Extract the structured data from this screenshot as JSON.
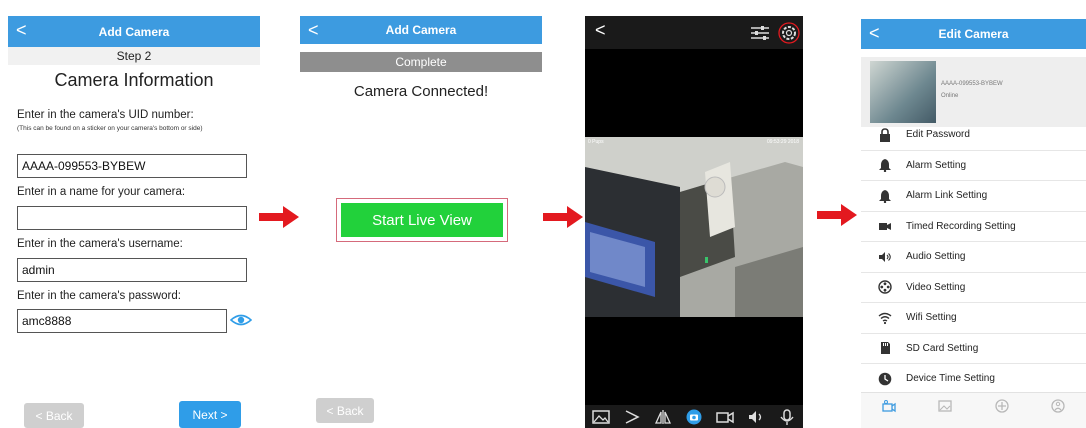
{
  "panel1": {
    "header_title": "Add Camera",
    "back_glyph": "<",
    "step": "Step 2",
    "title": "Camera Information",
    "uid_label": "Enter in the camera's UID number:",
    "uid_note": "(This can be found on a sticker on your camera's bottom or side)",
    "uid_value": "AAAA-099553-BYBEW",
    "name_label": "Enter in a name for your camera:",
    "name_value": "",
    "username_label": "Enter in the camera's username:",
    "username_value": "admin",
    "password_label": "Enter in the camera's password:",
    "password_value": "amc8888",
    "eye_icon": "eye-icon",
    "back_button": "< Back",
    "next_button": "Next >"
  },
  "panel2": {
    "header_title": "Add Camera",
    "back_glyph": "<",
    "complete": "Complete",
    "title": "Camera Connected!",
    "live_button": "Start Live View",
    "back_button": "< Back"
  },
  "panel3": {
    "back_glyph": "<",
    "osd_left": "0 Pups",
    "osd_right": "09:53:29 2018",
    "toolbar_icons": [
      "photo-icon",
      "play-icon",
      "mirror-icon",
      "snapshot-icon",
      "record-icon",
      "speaker-icon",
      "microphone-icon"
    ]
  },
  "panel4": {
    "header_title": "Edit Camera",
    "back_glyph": "<",
    "uid": "AAAA-099553-BYBEW",
    "status": "Online",
    "menu": [
      {
        "label": "Edit Password",
        "icon": "lock-icon"
      },
      {
        "label": "Alarm Setting",
        "icon": "bell-icon"
      },
      {
        "label": "Alarm Link Setting",
        "icon": "bell-icon"
      },
      {
        "label": "Timed Recording Setting",
        "icon": "video-camera-icon"
      },
      {
        "label": "Audio Setting",
        "icon": "speaker-icon"
      },
      {
        "label": "Video Setting",
        "icon": "film-reel-icon"
      },
      {
        "label": "Wifi Setting",
        "icon": "wifi-icon"
      },
      {
        "label": "SD Card Setting",
        "icon": "sd-card-icon"
      },
      {
        "label": "Device Time Setting",
        "icon": "clock-icon"
      }
    ],
    "tabs": [
      {
        "icon": "camera-tab-icon"
      },
      {
        "icon": "image-tab-icon"
      },
      {
        "icon": "target-tab-icon"
      },
      {
        "icon": "info-tab-icon"
      }
    ]
  },
  "colors": {
    "header_blue": "#3d9be0",
    "next_blue": "#2f9de8",
    "live_green": "#22d13b",
    "arrow_red": "#e3191f",
    "complete_gray": "#8e8e8e"
  }
}
